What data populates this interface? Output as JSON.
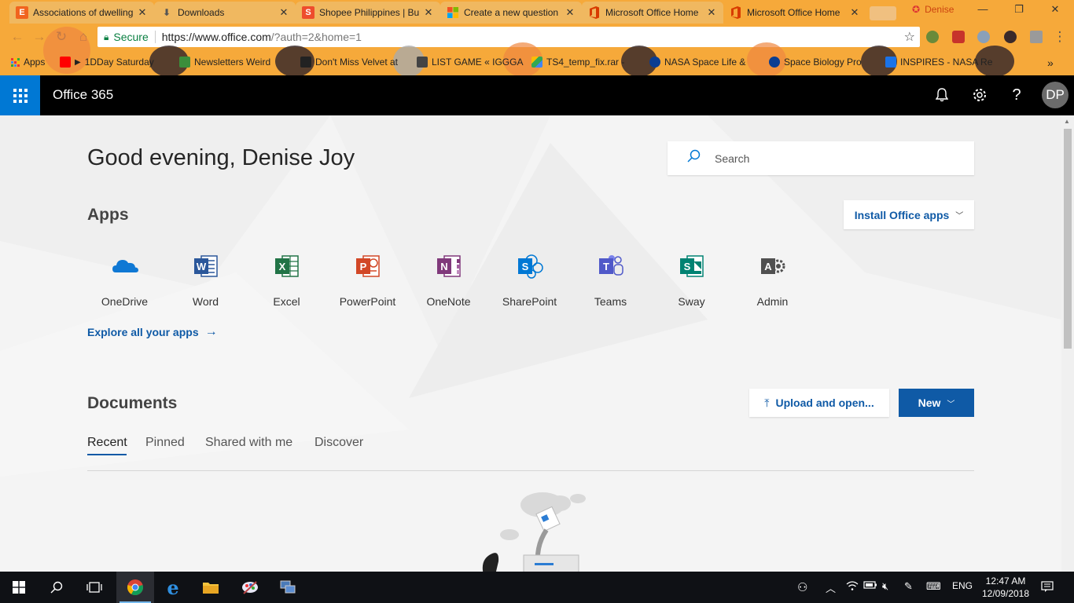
{
  "browser": {
    "tabs": [
      {
        "title": "Associations of dwelling",
        "favicon": "etsy-icon",
        "color": "#f1641e",
        "glyph": "E"
      },
      {
        "title": "Downloads",
        "favicon": "download-icon",
        "color": "#555555",
        "glyph": "⬇"
      },
      {
        "title": "Shopee Philippines | Bu",
        "favicon": "shopee-icon",
        "color": "#ee4d2d",
        "glyph": "S"
      },
      {
        "title": "Create a new question",
        "favicon": "microsoft-icon",
        "color": "#00a4ef",
        "glyph": ""
      },
      {
        "title": "Microsoft Office Home",
        "favicon": "office-icon",
        "color": "#d83b01",
        "glyph": ""
      },
      {
        "title": "Microsoft Office Home",
        "favicon": "office-icon",
        "color": "#d83b01",
        "glyph": "",
        "active": true
      }
    ],
    "profile_name": "Denise",
    "secure_label": "Secure",
    "url_host": "https://www.office.com",
    "url_path": "/?auth=2&home=1",
    "bookmarks": [
      {
        "label": "Apps",
        "color": "#4285f4"
      },
      {
        "label": "1DDay Saturday",
        "color": "#ff0000"
      },
      {
        "label": "Newsletters Weird",
        "color": "#3b8e3b"
      },
      {
        "label": "Don't Miss Velvet at",
        "color": "#222222"
      },
      {
        "label": "LIST GAME « IGGGA",
        "color": "#444444"
      },
      {
        "label": "TS4_temp_fix.rar -",
        "color": "#34a853"
      },
      {
        "label": "NASA Space Life &",
        "color": "#0b3d91"
      },
      {
        "label": "Space Biology Pro",
        "color": "#0b3d91"
      },
      {
        "label": "INSPIRES - NASA Re",
        "color": "#1a73e8"
      }
    ]
  },
  "header": {
    "suite_title": "Office 365",
    "avatar_initials": "DP"
  },
  "main": {
    "greeting": "Good evening, Denise Joy",
    "search_placeholder": "Search",
    "apps_title": "Apps",
    "install_label": "Install Office apps",
    "apps": [
      {
        "label": "OneDrive",
        "icon": "onedrive-icon",
        "color": "#0f78d4",
        "letter": ""
      },
      {
        "label": "Word",
        "icon": "word-icon",
        "color": "#2b579a",
        "letter": "W"
      },
      {
        "label": "Excel",
        "icon": "excel-icon",
        "color": "#217346",
        "letter": "X"
      },
      {
        "label": "PowerPoint",
        "icon": "powerpoint-icon",
        "color": "#d24726",
        "letter": "P"
      },
      {
        "label": "OneNote",
        "icon": "onenote-icon",
        "color": "#80397b",
        "letter": "N"
      },
      {
        "label": "SharePoint",
        "icon": "sharepoint-icon",
        "color": "#0078d4",
        "letter": "S"
      },
      {
        "label": "Teams",
        "icon": "teams-icon",
        "color": "#5059c9",
        "letter": "T"
      },
      {
        "label": "Sway",
        "icon": "sway-icon",
        "color": "#008272",
        "letter": "S"
      },
      {
        "label": "Admin",
        "icon": "admin-icon",
        "color": "#505050",
        "letter": "A"
      }
    ],
    "explore_label": "Explore all your apps",
    "documents_title": "Documents",
    "upload_label": "Upload and open...",
    "new_label": "New",
    "doc_tabs": [
      "Recent",
      "Pinned",
      "Shared with me",
      "Discover"
    ],
    "selected_doc_tab": "Recent"
  },
  "taskbar": {
    "language": "ENG",
    "time": "12:47 AM",
    "date": "12/09/2018"
  },
  "colors": {
    "accent": "#0078d4",
    "link": "#0f5aa6",
    "chrome_theme": "#f6a93a"
  }
}
